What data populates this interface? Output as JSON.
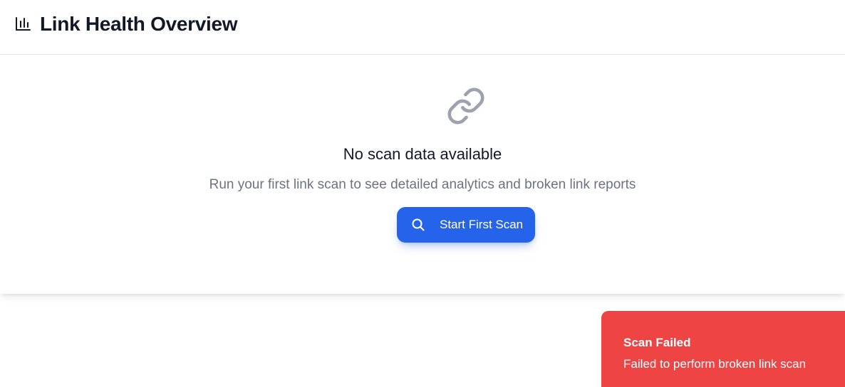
{
  "header": {
    "title": "Link Health Overview",
    "icon": "bar-chart-icon"
  },
  "empty_state": {
    "icon": "link-icon",
    "title": "No scan data available",
    "description": "Run your first link scan to see detailed analytics and broken link reports",
    "button": {
      "icon": "search-icon",
      "label": "Start First Scan"
    }
  },
  "toast": {
    "title": "Scan Failed",
    "message": "Failed to perform broken link scan"
  },
  "colors": {
    "primary": "#2563eb",
    "error": "#ef4444",
    "text_primary": "#111827",
    "text_secondary": "#6b7280",
    "icon_muted": "#9ca3af",
    "border": "#e5e7eb"
  }
}
